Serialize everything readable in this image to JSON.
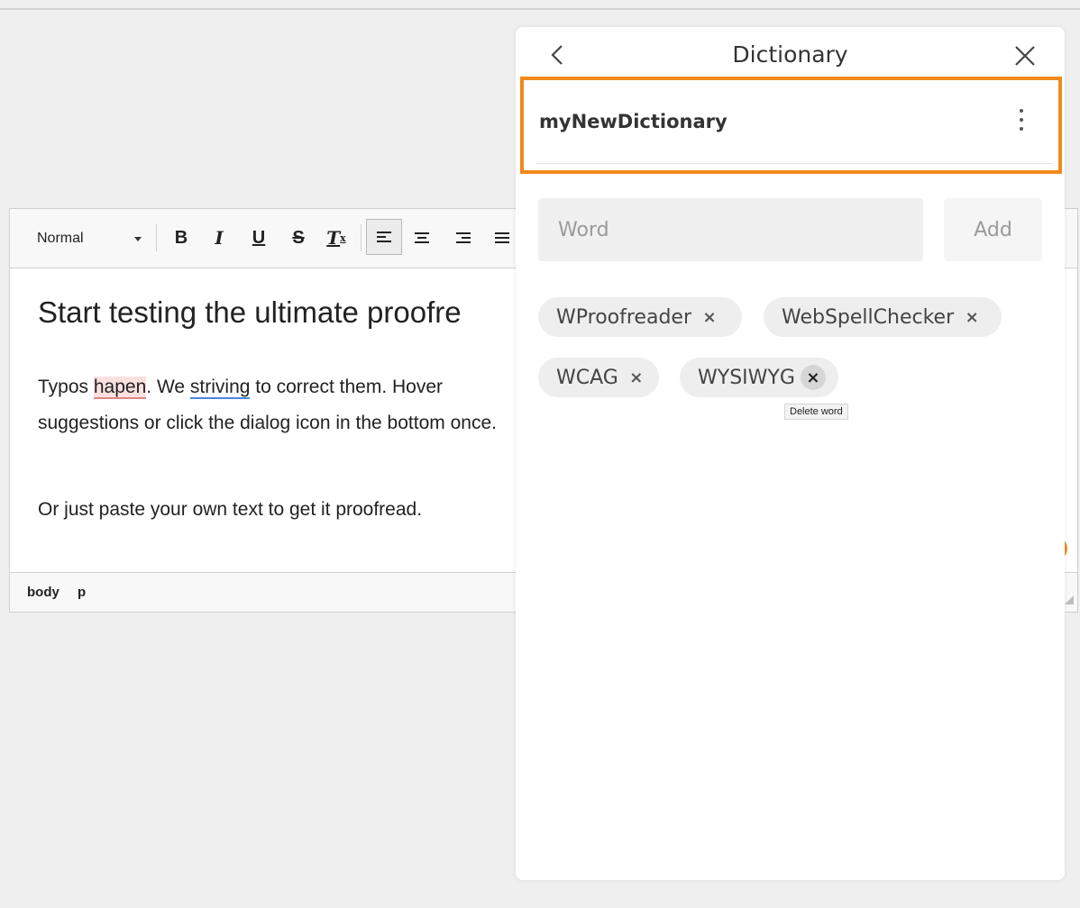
{
  "editor": {
    "toolbar": {
      "format_label": "Normal",
      "bold_label": "B",
      "italic_label": "I",
      "underline_label": "U",
      "strike_label": "S",
      "clear_label": "T",
      "clear_sub": "x"
    },
    "heading": "Start testing the ultimate proofre",
    "para1": {
      "t1": "Typos ",
      "misspelled": "hapen",
      "t2": ". We ",
      "grammar": "striving",
      "t3": " to correct them. Hover suggestions or click the dialog icon in the bottom once."
    },
    "para2": "Or just paste your own text to get it proofread.",
    "status": {
      "path1": "body",
      "path2": "p"
    }
  },
  "dictionary_panel": {
    "title": "Dictionary",
    "dictionary_name": "myNewDictionary",
    "word_input": {
      "placeholder": "Word",
      "value": ""
    },
    "add_label": "Add",
    "words": [
      {
        "label": "WProofreader"
      },
      {
        "label": "WebSpellChecker"
      },
      {
        "label": "WCAG"
      },
      {
        "label": "WYSIWYG"
      }
    ],
    "delete_symbol": "×",
    "tooltip": "Delete word"
  },
  "colors": {
    "highlight_border": "#f08a1c",
    "misspelling_underline": "#e08585",
    "grammar_underline": "#4a86e8"
  }
}
